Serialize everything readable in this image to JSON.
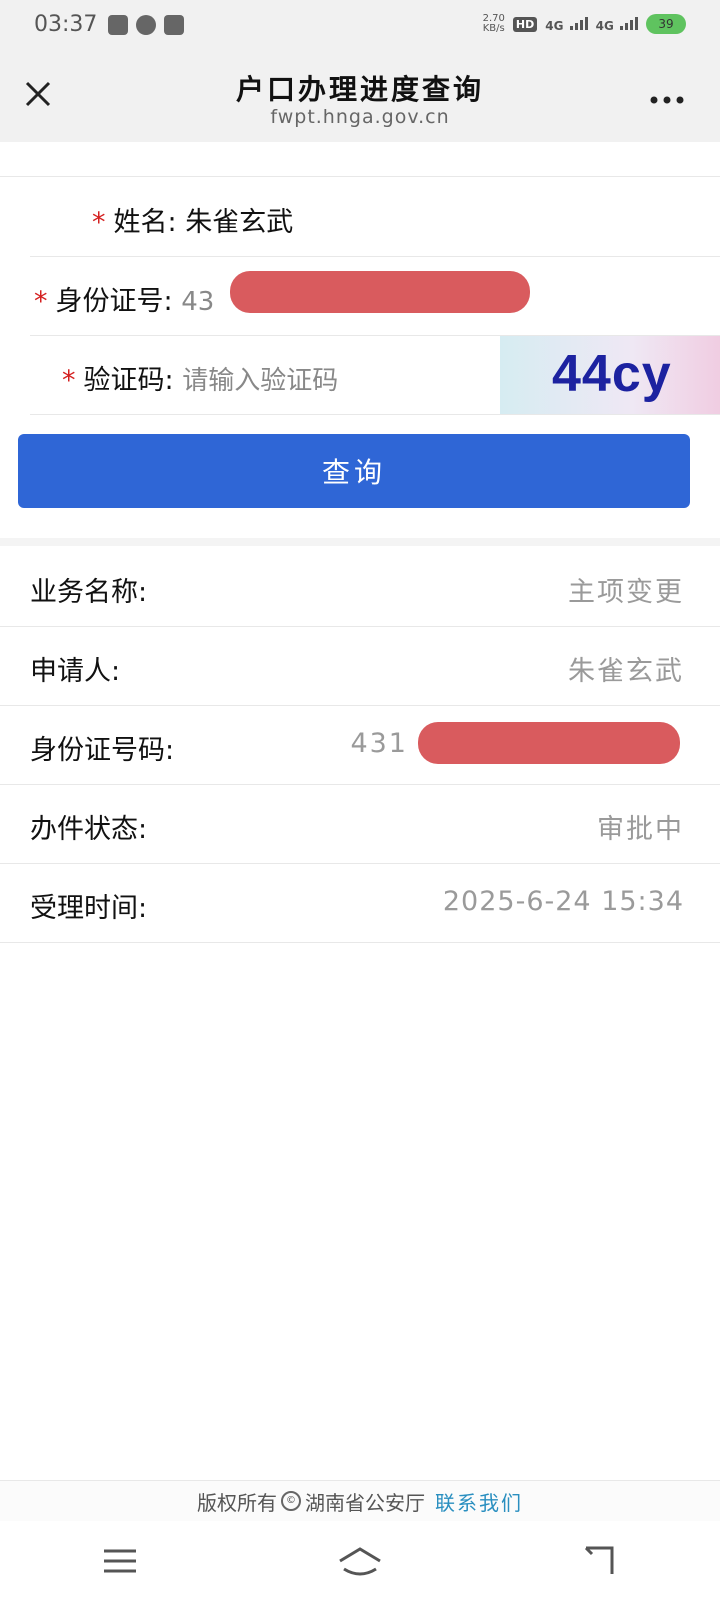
{
  "status_bar": {
    "time": "03:37",
    "speed_value": "2.70",
    "speed_unit": "KB/s",
    "hd": "HD",
    "sim1": "4G",
    "sim2": "4G",
    "battery": "39"
  },
  "header": {
    "title": "户口办理进度查询",
    "subtitle": "fwpt.hnga.gov.cn",
    "close_icon": "close-icon",
    "more_icon": "more-icon"
  },
  "form": {
    "name_label": "姓名:",
    "name_value": "朱雀玄武",
    "id_label": "身份证号:",
    "id_value_visible": "43",
    "captcha_label": "验证码:",
    "captcha_placeholder": "请输入验证码",
    "captcha_text": "44cy",
    "required_mark": "*",
    "submit_label": "查询"
  },
  "results": [
    {
      "label": "业务名称:",
      "value": "主项变更"
    },
    {
      "label": "申请人:",
      "value": "朱雀玄武"
    },
    {
      "label": "身份证号码:",
      "value": "431"
    },
    {
      "label": "办件状态:",
      "value": "审批中"
    },
    {
      "label": "受理时间:",
      "value": "2025-6-24 15:34"
    }
  ],
  "footer": {
    "copyright": "版权所有",
    "org": "湖南省公安厅",
    "contact": "联系我们"
  },
  "colors": {
    "primary": "#2f66d6",
    "required": "#d42020",
    "link": "#2a8fc0",
    "redaction": "#d95b5e"
  }
}
